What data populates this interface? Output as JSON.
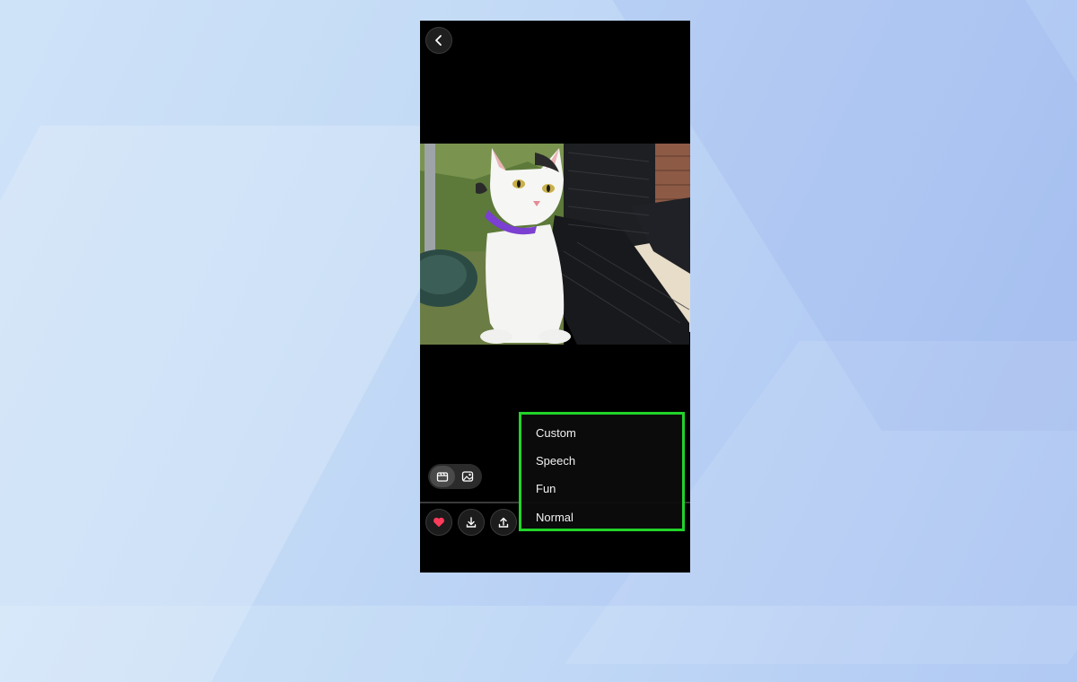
{
  "colors": {
    "menu_highlight_border": "#22d329",
    "favorite_heart": "#ff3b5c",
    "screen_background": "#000000"
  },
  "icons": {
    "back": "chevron-left-icon",
    "video_mode": "clapperboard-icon",
    "photo_mode": "image-icon",
    "favorite": "heart-icon",
    "download": "download-icon",
    "share": "upload-icon"
  },
  "speed_menu": {
    "items": [
      "Custom",
      "Speech",
      "Fun",
      "Normal"
    ]
  }
}
